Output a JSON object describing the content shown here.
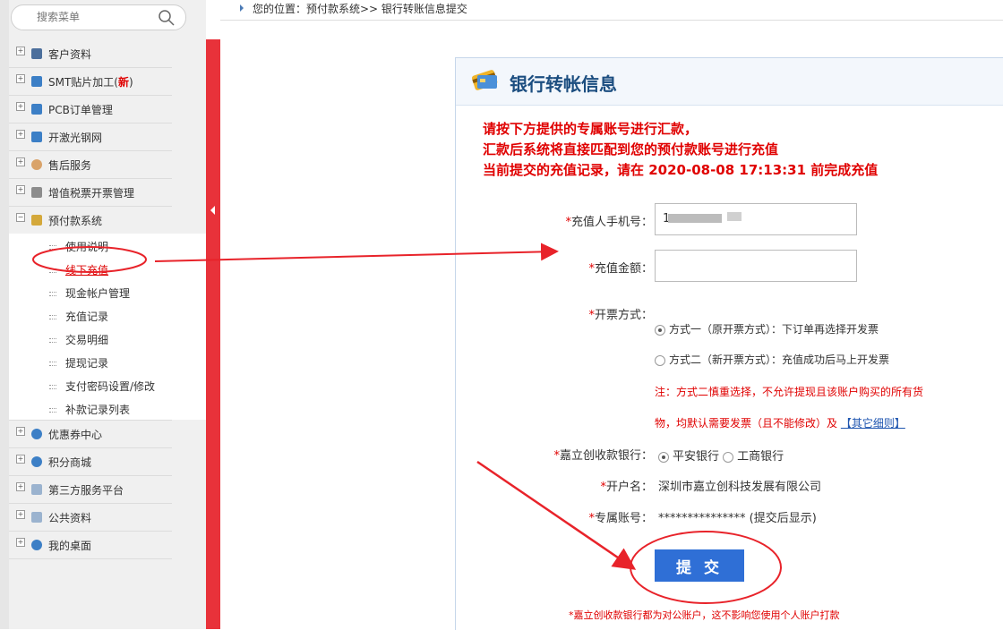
{
  "search": {
    "placeholder": "搜索菜单"
  },
  "breadcrumb": {
    "text": "您的位置：预付款系统>> 银行转账信息提交"
  },
  "menu": {
    "items": [
      {
        "label": "客户资料"
      },
      {
        "label": "SMT贴片加工(",
        "badge": "新",
        "suffix": ")"
      },
      {
        "label": "PCB订单管理"
      },
      {
        "label": "开激光钢网"
      },
      {
        "label": "售后服务"
      },
      {
        "label": "增值税票开票管理"
      },
      {
        "label": "预付款系统"
      },
      {
        "label": "优惠券中心"
      },
      {
        "label": "积分商城"
      },
      {
        "label": "第三方服务平台"
      },
      {
        "label": "公共资料"
      },
      {
        "label": "我的桌面"
      }
    ],
    "sub": [
      {
        "label": "使用说明"
      },
      {
        "label": "线下充值"
      },
      {
        "label": "现金帐户管理"
      },
      {
        "label": "充值记录"
      },
      {
        "label": "交易明细"
      },
      {
        "label": "提现记录"
      },
      {
        "label": "支付密码设置/修改"
      },
      {
        "label": "补款记录列表"
      }
    ]
  },
  "panel": {
    "title": "银行转帐信息",
    "notice": [
      "请按下方提供的专属账号进行汇款，",
      "汇款后系统将直接匹配到您的预付款账号进行充值",
      "当前提交的充值记录，请在 2020-08-08 17:13:31 前完成充值"
    ],
    "phone_label": "充值人手机号：",
    "phone_value": "1",
    "amount_label": "充值金额：",
    "amount_value": "",
    "invoice_label": "开票方式：",
    "invoice_opt1": "方式一（原开票方式）：下订单再选择开发票",
    "invoice_opt2": "方式二（新开票方式）：充值成功后马上开发票",
    "invoice_note1": "注：方式二慎重选择，不允许提现且该账户购买的所有货",
    "invoice_note2": "物，均默认需要发票（且不能修改）及",
    "invoice_link": "【其它细则】",
    "bank_label": "嘉立创收款银行：",
    "bank_opt1": "平安银行",
    "bank_opt2": "工商银行",
    "account_name_label": "开户名：",
    "account_name": "深圳市嘉立创科技发展有限公司",
    "account_no_label": "专属账号：",
    "account_no": "*************** (提交后显示)",
    "submit": "提 交",
    "footnote": "*嘉立创收款银行都为对公账户，这不影响您使用个人账户打款",
    "star": "*"
  }
}
